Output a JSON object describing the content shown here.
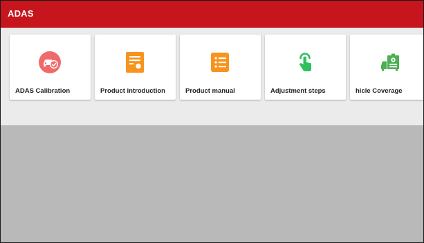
{
  "header": {
    "title": "ADAS"
  },
  "colors": {
    "header_red": "#c6151c",
    "calibration_icon": "#ef6b6b",
    "document_icon": "#f7941d",
    "touch_icon": "#2ebf5e",
    "coverage_icon": "#4caf50",
    "content_background": "#b9b9b9"
  },
  "tiles": [
    {
      "label": "ADAS Calibration",
      "icon": "adas-calibration-icon"
    },
    {
      "label": "Product introduction",
      "icon": "product-introduction-icon"
    },
    {
      "label": "Product manual",
      "icon": "product-manual-icon"
    },
    {
      "label": "Adjustment steps",
      "icon": "adjustment-steps-icon"
    },
    {
      "label": "hicle Coverage",
      "icon": "vehicle-coverage-icon"
    }
  ]
}
